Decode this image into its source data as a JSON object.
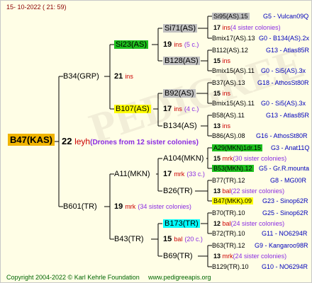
{
  "header": {
    "date": "15- 10-2022 ( 21: 59)"
  },
  "footer": {
    "copyright": "Copyright 2004-2022 © Karl Kehrle Foundation",
    "site": "www.pedigreeapis.org"
  },
  "queen": {
    "name": "B47(KAS)",
    "gen_num": "22",
    "gen_tag": "leyh",
    "sisters": "(Drones from 12 sister colonies)"
  },
  "gen1": [
    {
      "name": "B34(GRP)",
      "gen_num": "21",
      "gen_tag": "ins"
    },
    {
      "name": "B601(TR)",
      "gen_num": "19",
      "gen_tag": "mrk",
      "sisters": "(34 sister colonies)"
    }
  ],
  "gen2": [
    {
      "name": "Si23(AS)",
      "gen_num": "19",
      "gen_tag": "ins",
      "sisters": "(5 c.)"
    },
    {
      "name": "B107(AS)",
      "gen_num": "17",
      "gen_tag": "ins",
      "sisters": "(4 c.)"
    },
    {
      "name": "A11(MKN)",
      "gen_num": "17",
      "gen_tag": "mrk",
      "sisters": "(33 c.)"
    },
    {
      "name": "B43(TR)",
      "gen_num": "15",
      "gen_tag": "bal",
      "sisters": "(20 c.)"
    }
  ],
  "gen3": [
    {
      "name": "Si71(AS)",
      "gen_num": "17",
      "gen_tag": "ins",
      "sisters": "(4 sister colonies)"
    },
    {
      "name": "B128(AS)",
      "gen_num": "15",
      "gen_tag": "ins"
    },
    {
      "name": "B92(AS)",
      "gen_num": "15",
      "gen_tag": "ins"
    },
    {
      "name": "B134(AS)",
      "gen_num": "13",
      "gen_tag": "ins"
    },
    {
      "name": "A104(MKN)",
      "gen_num": "15",
      "gen_tag": "mrk",
      "sisters": "(30 sister colonies)"
    },
    {
      "name": "B26(TR)",
      "gen_num": "13",
      "gen_tag": "bal",
      "sisters": "(22 sister colonies)"
    },
    {
      "name": "B173(TR)",
      "gen_num": "12",
      "gen_tag": "bal",
      "sisters": "(24 sister colonies)"
    },
    {
      "name": "B69(TR)",
      "gen_num": "13",
      "gen_tag": "mrk",
      "sisters": "(24 sister colonies)"
    }
  ],
  "gen4": [
    {
      "name": "Si95(AS).15",
      "info": "G5 - Vulcan09Q"
    },
    {
      "name": "Bmix17(AS).13",
      "info": "G0 - B134(AS).2x"
    },
    {
      "name": "B112(AS).12",
      "info": "G13 - Atlas85R"
    },
    {
      "name": "Bmix15(AS).11",
      "info": "G0 - Si5(AS).3x"
    },
    {
      "name": "B37(AS).13",
      "info": "G18 - AthosSt80R"
    },
    {
      "name": "Bmix15(AS).11",
      "info": "G0 - Si5(AS).3x"
    },
    {
      "name": "B58(AS).11",
      "info": "G13 - Atlas85R"
    },
    {
      "name": "B86(AS).08",
      "info": "G16 - AthosSt80R"
    },
    {
      "name": "A29(MKN)1dr.15",
      "info": "G3 - Anat11Q"
    },
    {
      "name": "B53(MKN).12",
      "info": "G5 - Gr.R.mounta"
    },
    {
      "name": "B77(TR).12",
      "info": "G8 - MG00R"
    },
    {
      "name": "B47(MKK).09",
      "info": "G23 - Sinop62R"
    },
    {
      "name": "B70(TR).10",
      "info": "G25 - Sinop62R"
    },
    {
      "name": "B72(TR).10",
      "info": "G11 - NO6294R"
    },
    {
      "name": "B63(TR).12",
      "info": "G9 - Kangaroo98R"
    },
    {
      "name": "B129(TR).10",
      "info": "G10 - NO6294R"
    }
  ],
  "colors": {
    "green": "#1ec01e",
    "yellow": "#ffff00",
    "gray": "#c0c0c0",
    "cyan": "#00ffff",
    "orange": "#f0b400",
    "red": "#cc0000",
    "purple": "#8a2be2",
    "blue": "#0000bb"
  }
}
